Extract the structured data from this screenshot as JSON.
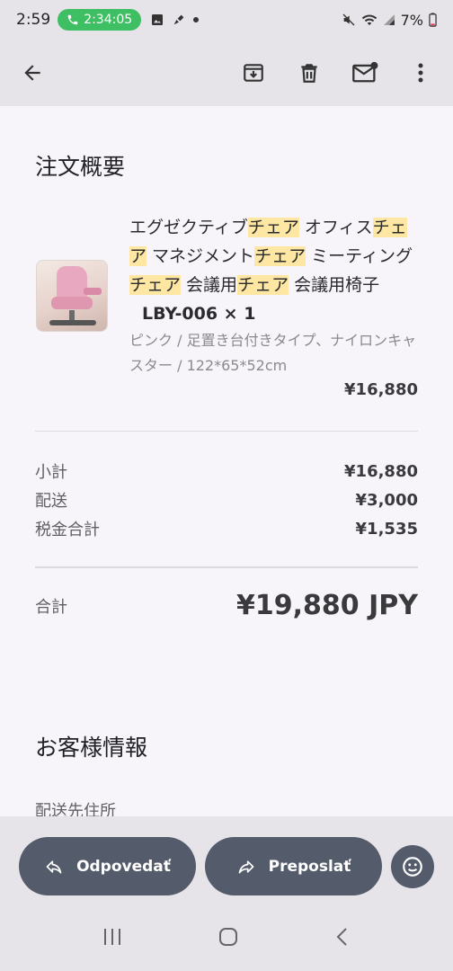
{
  "status_bar": {
    "time": "2:59",
    "call_timer": "2:34:05",
    "battery": "7%"
  },
  "appbar": {
    "icons": [
      "back-arrow-icon",
      "archive-icon",
      "delete-icon",
      "mark-unread-icon",
      "more-vert-icon"
    ]
  },
  "order": {
    "heading": "注文概要",
    "item": {
      "title_parts": [
        {
          "t": "エグゼクティブ",
          "hl": false
        },
        {
          "t": "チェア",
          "hl": true
        },
        {
          "t": " オフィス",
          "hl": false
        },
        {
          "t": "チェア",
          "hl": true
        },
        {
          "t": " マネジメント",
          "hl": false
        },
        {
          "t": "チェア",
          "hl": true
        },
        {
          "t": " ミーティング",
          "hl": false
        },
        {
          "t": "チェア",
          "hl": true
        },
        {
          "t": " 会議用",
          "hl": false
        },
        {
          "t": "チェア",
          "hl": true
        },
        {
          "t": " 会議用椅子",
          "hl": false
        }
      ],
      "quantity": "LBY-006 × 1",
      "variant": "ピンク / 足置き台付きタイプ、ナイロンキャスター / 122*65*52cm",
      "price": "¥16,880"
    },
    "summary": [
      {
        "label": "小計",
        "value": "¥16,880"
      },
      {
        "label": "配送",
        "value": "¥3,000"
      },
      {
        "label": "税金合計",
        "value": "¥1,535"
      }
    ],
    "total": {
      "label": "合計",
      "value": "¥19,880 JPY"
    }
  },
  "customer": {
    "heading": "お客様情報",
    "address_label": "配送先住所"
  },
  "actions": {
    "reply": "Odpovedať",
    "forward": "Preposlať"
  }
}
